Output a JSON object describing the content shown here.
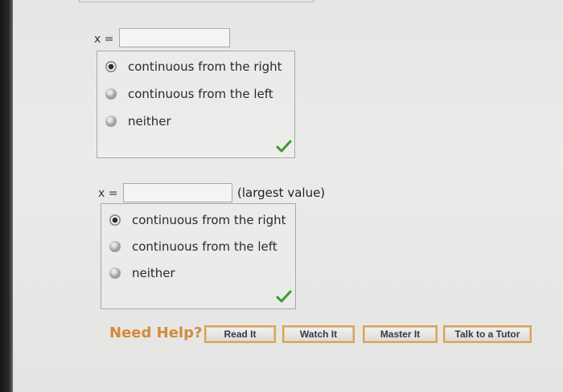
{
  "part1": {
    "eq_label": "x =",
    "input_value": "",
    "options": [
      {
        "label": "continuous from the right",
        "selected": true
      },
      {
        "label": "continuous from the left",
        "selected": false
      },
      {
        "label": "neither",
        "selected": false
      }
    ],
    "status": "correct"
  },
  "part2": {
    "eq_label": "x =",
    "input_value": "",
    "suffix": "(largest value)",
    "options": [
      {
        "label": "continuous from the right",
        "selected": true
      },
      {
        "label": "continuous from the left",
        "selected": false
      },
      {
        "label": "neither",
        "selected": false
      }
    ],
    "status": "correct"
  },
  "help": {
    "title": "Need Help?",
    "buttons": [
      {
        "label": "Read It"
      },
      {
        "label": "Watch It"
      },
      {
        "label": "Master It"
      },
      {
        "label": "Talk to a Tutor"
      }
    ]
  },
  "colors": {
    "accent": "#e3a14b",
    "check": "#3b9a2f"
  },
  "icons": {
    "status_correct": "checkmark-icon",
    "radio_selected": "radio-selected-icon",
    "radio_unselected": "radio-unselected-icon"
  }
}
